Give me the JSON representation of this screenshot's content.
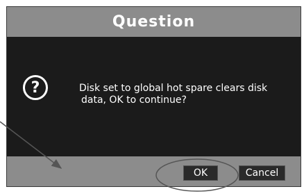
{
  "dialog": {
    "title": "Question",
    "icon": "question-mark-icon",
    "icon_glyph": "?",
    "message_line1": "Disk set to global hot spare clears disk",
    "message_line2": "data, OK to continue?"
  },
  "buttons": {
    "ok_label": "OK",
    "cancel_label": "Cancel"
  },
  "colors": {
    "title_bar": "#8c8c8c",
    "body": "#1b1b1b",
    "button": "#2a2a2a",
    "annotation": "#555555"
  }
}
